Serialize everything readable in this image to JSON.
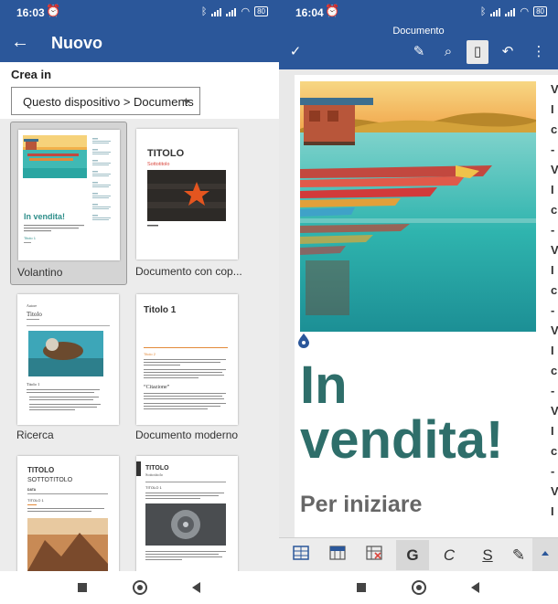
{
  "left_screen": {
    "status_time": "16:03",
    "battery": "80",
    "title": "Nuovo",
    "crea_in_label": "Crea in",
    "location_value": "Questo dispositivo > Documents",
    "templates": [
      {
        "label": "Volantino",
        "selected": true,
        "thumb_title": "In vendita!",
        "thumb_heading": "Titolo 1"
      },
      {
        "label": "Documento con cop...",
        "selected": false,
        "thumb_title": "TITOLO",
        "thumb_subtitle": "Sottotitolo"
      },
      {
        "label": "Ricerca",
        "selected": false,
        "thumb_title": "Titolo",
        "thumb_heading": "Titolo 1"
      },
      {
        "label": "Documento moderno",
        "selected": false,
        "thumb_title": "Titolo 1",
        "thumb_quote": "“Citazione”",
        "thumb_heading": "Titolo 2"
      },
      {
        "label": "",
        "selected": false,
        "thumb_title": "TITOLO",
        "thumb_subtitle": "SOTTOTITOLO",
        "thumb_heading": "TITOLO 1"
      },
      {
        "label": "",
        "selected": false,
        "thumb_title": "TITOLO",
        "thumb_subtitle": "Sottotitolo",
        "thumb_heading": "TITOLO 1"
      }
    ]
  },
  "right_screen": {
    "status_time": "16:04",
    "battery": "80",
    "doc_title": "Documento",
    "page_title_line1": "In",
    "page_title_line2": "vendita!",
    "page_subtitle": "Per iniziare",
    "side_letters": [
      "V",
      "I",
      "c",
      "-",
      "V",
      "I",
      "c",
      "-",
      "V",
      "I",
      "c",
      "-",
      "V",
      "I",
      "c",
      "-",
      "V",
      "I",
      "c",
      "-",
      "V",
      "I"
    ],
    "format_buttons": [
      {
        "name": "table-layout-icon"
      },
      {
        "name": "table-insert-icon"
      },
      {
        "name": "table-delete-icon"
      },
      {
        "name": "bold-button",
        "label": "G",
        "active": true
      },
      {
        "name": "italic-button",
        "label": "C"
      },
      {
        "name": "underline-button",
        "label": "S"
      },
      {
        "name": "highlight-icon"
      }
    ]
  },
  "colors": {
    "word_blue": "#2b579a",
    "title_teal": "#2e6e6a",
    "accent_red": "#d9463c"
  }
}
